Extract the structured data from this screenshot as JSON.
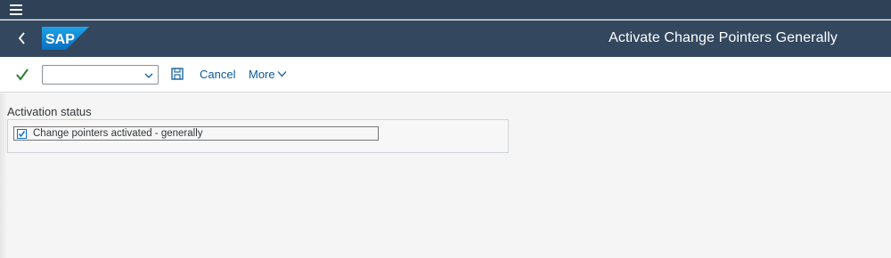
{
  "shell": {
    "title": "Activate Change Pointers Generally",
    "logo_text": "SAP",
    "colors": {
      "header_bg": "#33475e",
      "menubar_bg": "#2e4156",
      "logo_blue": "#0a8ad6",
      "link_blue": "#0a5a9c",
      "check_green": "#2b7d2b"
    }
  },
  "toolbar": {
    "command_field_value": "",
    "cancel_label": "Cancel",
    "more_label": "More"
  },
  "icons": {
    "menu": "hamburger-menu-icon",
    "back": "back-chevron-icon",
    "enter": "checkmark-icon",
    "save": "save-icon",
    "dropdown": "chevron-down-icon",
    "more": "chevron-down-icon"
  },
  "content": {
    "group_title": "Activation status",
    "checkbox_label": "Change pointers activated - generally",
    "checkbox_checked": true
  }
}
